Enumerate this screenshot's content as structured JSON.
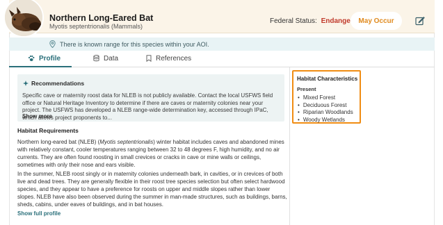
{
  "header": {
    "title": "Northern Long-Eared Bat",
    "subtitle": "Myotis septentrionalis (Mammals)",
    "status_label": "Federal Status:",
    "status_value": "Endangered",
    "occurrence_label": "May Occur",
    "edit_icon": "edit-icon"
  },
  "banner": {
    "icon": "location-pin-icon",
    "text": "There is known range for this species within your AOI."
  },
  "tabs": [
    {
      "label": "Profile",
      "icon": "paw-icon",
      "active": true
    },
    {
      "label": "Data",
      "icon": "database-icon",
      "active": false
    },
    {
      "label": "References",
      "icon": "bookmark-icon",
      "active": false
    }
  ],
  "recommendations": {
    "title": "Recommendations",
    "text": "Specific cave or maternity roost data for NLEB is not publicly available. Contact the local USFWS field office or Natural Heritage Inventory to determine if there are caves or maternity colonies near your project. The USFWS has developed a NLEB range-wide determination key, accessed through IPaC, which allows project proponents to...",
    "show_more": "Show more"
  },
  "habitat_requirements": {
    "heading": "Habitat Requirements",
    "para1_pre": "Northern long-eared bat (NLEB) (",
    "para1_italic": "Myotis septentrionalis",
    "para1_post": ") winter habitat includes caves and abandoned mines with relatively constant, cooler temperatures ranging between 32 to 48 degrees F, high humidity, and no air currents. They are often found roosting in small crevices or cracks in cave or mine walls or ceilings, sometimes with only their nose and ears visible.",
    "para2": "In the summer, NLEB roost singly or in maternity colonies underneath bark, in cavities, or in crevices of both live and dead trees. They are generally flexible in their roost tree species selection but often select hardwood species, and they appear to have a preference for roosts on upper and middle slopes rather than lower slopes. NLEB have also been observed during the summer in man-made structures, such as buildings, barns, sheds, cabins, under eaves of buildings, and in bat houses.",
    "show_full": "Show full profile"
  },
  "habitat_characteristics": {
    "title": "Habitat Characteristics",
    "present_label": "Present",
    "items": [
      "Mixed Forest",
      "Deciduous Forest",
      "Riparian Woodlands",
      "Woody Wetlands"
    ]
  },
  "colors": {
    "accent": "#2a6f7a",
    "status_red": "#c0392b",
    "occur_orange": "#e08a1e",
    "highlight_orange": "#f08c12"
  }
}
